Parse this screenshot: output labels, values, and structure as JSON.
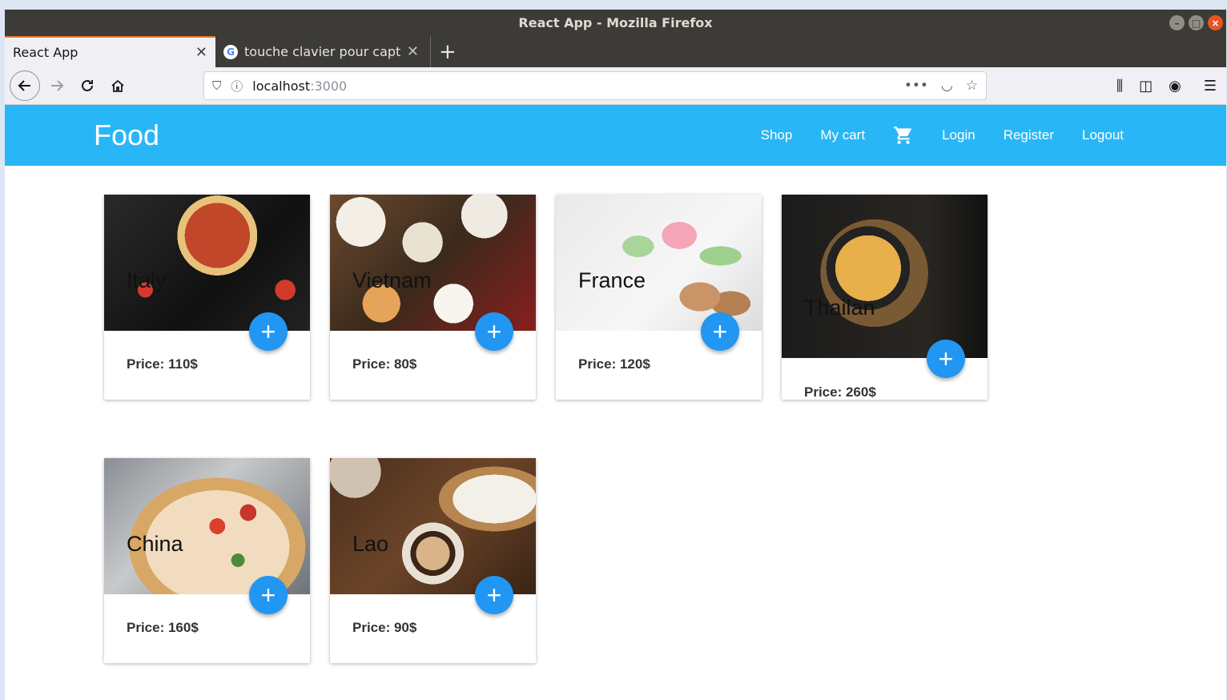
{
  "window": {
    "title": "React App - Mozilla Firefox"
  },
  "tabs": [
    {
      "label": "React App",
      "active": true
    },
    {
      "label": "touche clavier pour capt",
      "active": false
    }
  ],
  "urlbar": {
    "host": "localhost",
    "port": ":3000"
  },
  "app": {
    "brand": "Food",
    "menu": {
      "shop": "Shop",
      "my_cart": "My cart",
      "login": "Login",
      "register": "Register",
      "logout": "Logout"
    }
  },
  "products": [
    {
      "country": "Italy",
      "price": "Price: 110$"
    },
    {
      "country": "Vietnam",
      "price": "Price: 80$"
    },
    {
      "country": "France",
      "price": "Price: 120$"
    },
    {
      "country": "Thailan",
      "price": "Price: 260$"
    },
    {
      "country": "China",
      "price": "Price: 160$"
    },
    {
      "country": "Lao",
      "price": "Price: 90$"
    }
  ],
  "add_label": "+",
  "colors": {
    "appbar": "#29b6f6",
    "fab": "#2196f3",
    "tab_accent": "#e0772e"
  }
}
